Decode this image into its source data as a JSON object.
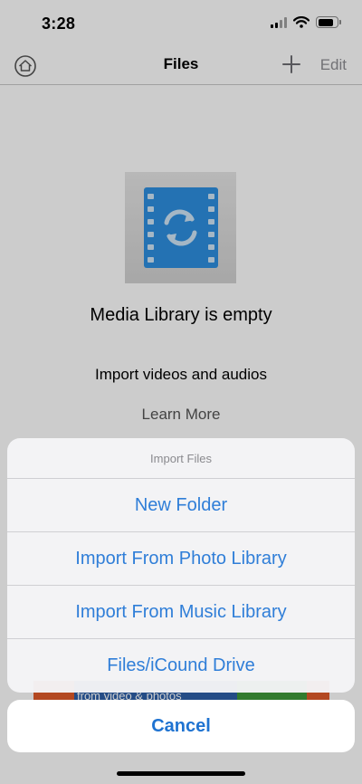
{
  "status_bar": {
    "time": "3:28",
    "battery_level": 0.85,
    "signal_bars": 2
  },
  "nav": {
    "title": "Files",
    "edit_label": "Edit",
    "left_icon": "settings-house-icon",
    "add_icon": "plus-icon"
  },
  "empty_state": {
    "title": "Media Library is empty",
    "subtitle": "Import videos and audios",
    "learn_more": "Learn More",
    "icon": "video-convert-icon"
  },
  "banner": {
    "text": "from video & photos"
  },
  "action_sheet": {
    "title": "Import Files",
    "items": [
      {
        "label": "New Folder"
      },
      {
        "label": "Import From Photo Library"
      },
      {
        "label": "Import From Music Library"
      },
      {
        "label": "Files/iCound Drive"
      }
    ],
    "cancel_label": "Cancel"
  },
  "colors": {
    "action_blue": "#2f7ed8",
    "icon_blue": "#2d8fe0"
  }
}
